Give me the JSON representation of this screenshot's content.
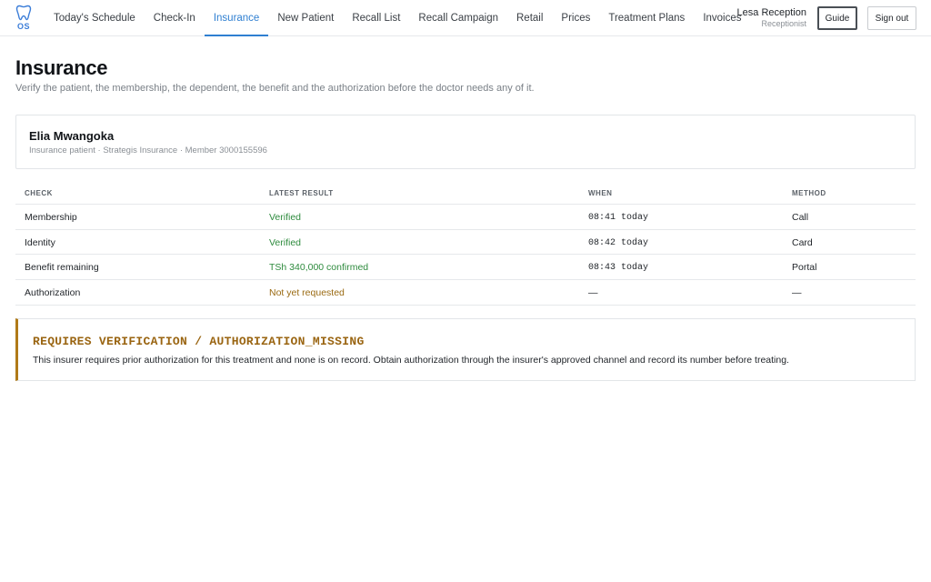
{
  "app": {
    "logo_text": "OS",
    "logo_icon": "tooth-icon"
  },
  "nav": {
    "items": [
      {
        "label": "Today's Schedule",
        "active": false
      },
      {
        "label": "Check-In",
        "active": false
      },
      {
        "label": "Insurance",
        "active": true
      },
      {
        "label": "New Patient",
        "active": false
      },
      {
        "label": "Recall List",
        "active": false
      },
      {
        "label": "Recall Campaign",
        "active": false
      },
      {
        "label": "Retail",
        "active": false
      },
      {
        "label": "Prices",
        "active": false
      },
      {
        "label": "Treatment Plans",
        "active": false
      },
      {
        "label": "Invoices",
        "active": false
      }
    ]
  },
  "user": {
    "name": "Lesa Reception",
    "role": "Receptionist"
  },
  "buttons": {
    "guide": "Guide",
    "sign_out": "Sign out"
  },
  "page": {
    "title": "Insurance",
    "subtitle": "Verify the patient, the membership, the dependent, the benefit and the authorization before the doctor needs any of it."
  },
  "patient": {
    "name": "Elia Mwangoka",
    "meta": "Insurance patient · Strategis Insurance · Member 3000155596"
  },
  "checks": {
    "headers": {
      "check": "Check",
      "result": "Latest result",
      "when": "When",
      "method": "Method"
    },
    "rows": [
      {
        "check": "Membership",
        "result": "Verified",
        "status": "ok",
        "when": "08:41 today",
        "method": "Call"
      },
      {
        "check": "Identity",
        "result": "Verified",
        "status": "ok",
        "when": "08:42 today",
        "method": "Card"
      },
      {
        "check": "Benefit remaining",
        "result": "TSh 340,000 confirmed",
        "status": "ok",
        "when": "08:43 today",
        "method": "Portal"
      },
      {
        "check": "Authorization",
        "result": "Not yet requested",
        "status": "warn",
        "when": "—",
        "method": "—"
      }
    ]
  },
  "alert": {
    "title": "REQUIRES VERIFICATION / AUTHORIZATION_MISSING",
    "body": "This insurer requires prior authorization for this treatment and none is on record. Obtain authorization through the insurer's approved channel and record its number before treating."
  },
  "colors": {
    "accent": "#2f7fd1",
    "ok": "#2e8b3e",
    "warn": "#9a6a12",
    "alert_border": "#b07a18"
  }
}
